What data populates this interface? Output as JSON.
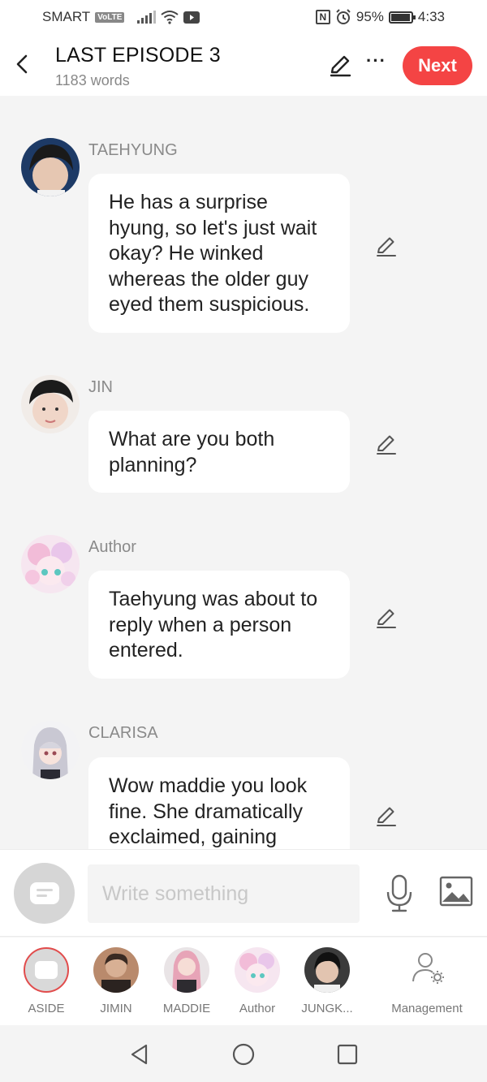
{
  "status_bar": {
    "carrier": "SMART",
    "volte": "VoLTE",
    "battery": "95%",
    "time": "4:33"
  },
  "header": {
    "title": "LAST EPISODE 3",
    "word_count": "1183 words",
    "next_label": "Next",
    "more_label": "···"
  },
  "messages": [
    {
      "sender": "TAEHYUNG",
      "text": "He has a surprise hyung, so let's just wait okay? He winked whereas the older guy eyed them suspicious."
    },
    {
      "sender": "JIN",
      "text": "What are you both planning?"
    },
    {
      "sender": "Author",
      "text": "Taehyung was about to reply when a person entered."
    },
    {
      "sender": "CLARISA",
      "text": "Wow maddie you look fine. She dramatically exclaimed, gaining"
    }
  ],
  "composer": {
    "placeholder": "Write something"
  },
  "characters": [
    {
      "label": "ASIDE"
    },
    {
      "label": "JIMIN"
    },
    {
      "label": "MADDIE"
    },
    {
      "label": "Author"
    },
    {
      "label": "JUNGK..."
    }
  ],
  "management_label": "Management",
  "colors": {
    "accent": "#f44444",
    "background": "#f4f4f4",
    "bubble": "#ffffff",
    "muted_text": "#8a8a8a"
  }
}
